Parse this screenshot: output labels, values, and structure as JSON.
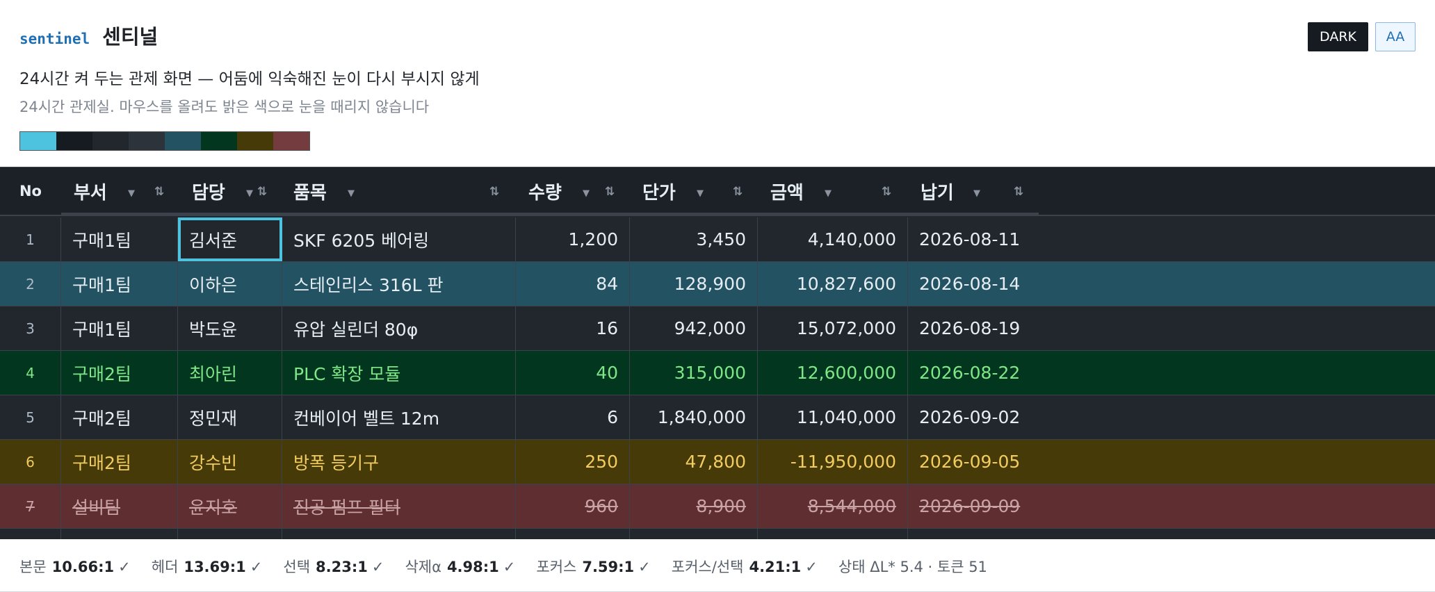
{
  "header": {
    "brand_mono": "sentinel",
    "brand_title": "센티널",
    "subtitle": "24시간 켜 두는 관제 화면 — 어둠에 익숙해진 눈이 다시 부시지 않게",
    "subnote": "24시간 관제실. 마우스를 올려도 밝은 색으로 눈을 때리지 않습니다",
    "swatches": [
      "#4ec3e0",
      "#161b22",
      "#22272e",
      "#2d333b",
      "#235362",
      "#03361e",
      "#463a08",
      "#743c3e"
    ]
  },
  "buttons": {
    "dark": "DARK",
    "aa": "AA"
  },
  "table": {
    "columns": [
      "No",
      "부서",
      "담당",
      "품목",
      "수량",
      "단가",
      "금액",
      "납기"
    ],
    "rows": [
      [
        "1",
        "구매1팀",
        "김서준",
        "SKF 6205 베어링",
        "1,200",
        "3,450",
        "4,140,000",
        "2026-08-11"
      ],
      [
        "2",
        "구매1팀",
        "이하은",
        "스테인리스 316L 판",
        "84",
        "128,900",
        "10,827,600",
        "2026-08-14"
      ],
      [
        "3",
        "구매1팀",
        "박도윤",
        "유압 실린더 80φ",
        "16",
        "942,000",
        "15,072,000",
        "2026-08-19"
      ],
      [
        "4",
        "구매2팀",
        "최아린",
        "PLC 확장 모듈",
        "40",
        "315,000",
        "12,600,000",
        "2026-08-22"
      ],
      [
        "5",
        "구매2팀",
        "정민재",
        "컨베이어 벨트 12m",
        "6",
        "1,840,000",
        "11,040,000",
        "2026-09-02"
      ],
      [
        "6",
        "구매2팀",
        "강수빈",
        "방폭 등기구",
        "250",
        "47,800",
        "-11,950,000",
        "2026-09-05"
      ],
      [
        "7",
        "설비팀",
        "윤지호",
        "진공 펌프 필터",
        "960",
        "8,900",
        "8,544,000",
        "2026-09-09"
      ]
    ],
    "row_states": [
      "normal",
      "selected",
      "normal",
      "success",
      "normal",
      "warning",
      "deleted"
    ]
  },
  "footer": {
    "metrics": [
      {
        "label": "본문",
        "value": "10.66:1",
        "check": "✓"
      },
      {
        "label": "헤더",
        "value": "13.69:1",
        "check": "✓"
      },
      {
        "label": "선택",
        "value": "8.23:1",
        "check": "✓"
      },
      {
        "label": "삭제α",
        "value": "4.98:1",
        "check": "✓"
      },
      {
        "label": "포커스",
        "value": "7.59:1",
        "check": "✓"
      },
      {
        "label": "포커스/선택",
        "value": "4.21:1",
        "check": "✓"
      }
    ],
    "status": "상태 ΔL* 5.4 · 토큰 51"
  }
}
